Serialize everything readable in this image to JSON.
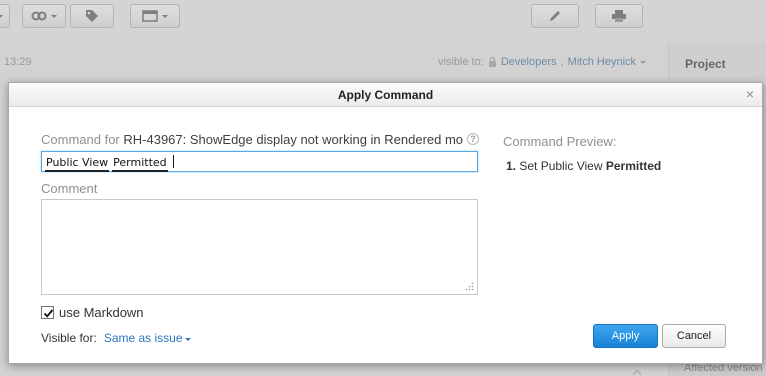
{
  "background": {
    "time": "13:29",
    "visible_to_label": "visible to:",
    "visible_to_groups": "Developers",
    "visible_to_separator": ",",
    "visible_to_user": "Mitch Heynick",
    "project_heading": "Project",
    "affected_label": "Affected version"
  },
  "dialog": {
    "title": "Apply Command",
    "close_glyph": "×",
    "command_label": "Command for",
    "issue_id": "RH-43967:",
    "issue_summary": "ShowEdge display not working in Rendered mo",
    "help_glyph": "?",
    "command_tokens": [
      "Public View",
      "Permitted"
    ],
    "comment_label": "Comment",
    "comment_value": "",
    "markdown_checked": true,
    "markdown_label": "use Markdown",
    "visible_for_label": "Visible for:",
    "visible_for_value": "Same as issue",
    "preview_title": "Command Preview:",
    "preview_number": "1.",
    "preview_action": "Set Public View",
    "preview_value": "Permitted",
    "apply_label": "Apply",
    "cancel_label": "Cancel"
  },
  "colors": {
    "accent": "#1883d6",
    "link": "#2d76bd",
    "input_focus": "#5aa9e6"
  }
}
